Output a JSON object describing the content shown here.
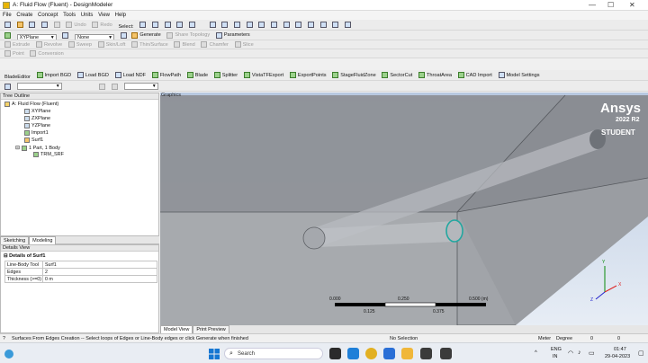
{
  "window": {
    "title": "A: Fluid Flow (Fluent) - DesignModeler"
  },
  "menu": [
    "File",
    "Create",
    "Concept",
    "Tools",
    "Units",
    "View",
    "Help"
  ],
  "toolbar1": {
    "undo": "Undo",
    "redo": "Redo",
    "select_label": "Select:"
  },
  "toolbar2": {
    "plane_value": "XYPlane",
    "sketch_value": "None",
    "generate": "Generate",
    "share_topology": "Share Topology",
    "parameters": "Parameters"
  },
  "toolbar3": [
    "Extrude",
    "Revolve",
    "Sweep",
    "Skin/Loft",
    "Thin/Surface",
    "Blend",
    "Chamfer",
    "Slice"
  ],
  "toolbar4": [
    "Point",
    "Conversion"
  ],
  "toolbar5": [
    "BladeEditor",
    "Import BGD",
    "Load BGD",
    "Load NDF",
    "FlowPath",
    "Blade",
    "Splitter",
    "VistaTFExport",
    "ExportPoints",
    "StageFluidZone",
    "SectorCut",
    "ThroatArea",
    "CAD Import",
    "Model Settings"
  ],
  "tree": {
    "header": "Tree Outline",
    "items": [
      "A: Fluid Flow (Fluent)",
      "XYPlane",
      "ZXPlane",
      "YZPlane",
      "Import1",
      "Surf1",
      "1 Part, 1 Body",
      "TRM_SRF"
    ]
  },
  "tabs_left": [
    "Sketching",
    "Modeling"
  ],
  "details": {
    "header": "Details View",
    "section": "Details of Surf1",
    "rows": [
      {
        "label": "Line-Body Tool",
        "value": "Surf1"
      },
      {
        "label": "Edges",
        "value": "2"
      },
      {
        "label": "Thickness (>=0)",
        "value": "0 m"
      }
    ]
  },
  "graphics": {
    "label": "Graphics",
    "brand": "Ansys",
    "version": "2022 R2",
    "edition": "STUDENT",
    "scale": {
      "top_ticks": [
        "0.000",
        "0.250",
        "0.500 (m)"
      ],
      "bottom_ticks": [
        "0.125",
        "0.375"
      ]
    },
    "axes": {
      "x": "X",
      "y": "Y",
      "z": "Z"
    }
  },
  "tabs_bottom": [
    "Model View",
    "Print Preview"
  ],
  "status": {
    "message": "Surfaces From Edges Creation -- Select loops of Edges or Line-Body edges or click Generate when finished",
    "selection": "No Selection",
    "units": "Meter",
    "angle": "Degree",
    "v1": "0",
    "v2": "0"
  },
  "taskbar": {
    "search": "Search",
    "lang": "ENG",
    "region": "IN",
    "time": "01:47",
    "date": "29-04-2023"
  },
  "colors": {
    "accent_teal": "#23a7a0",
    "model_face": "#8c8f95",
    "background_top": "#b7c8e0"
  }
}
